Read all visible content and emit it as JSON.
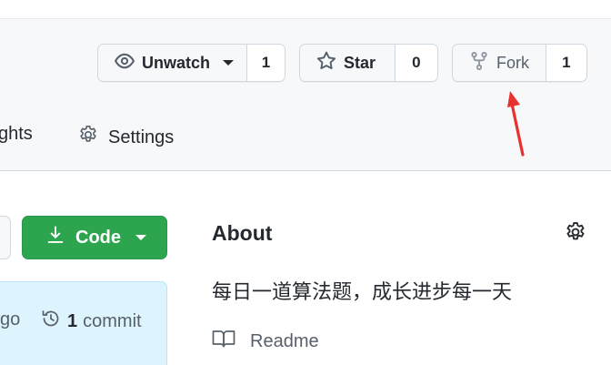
{
  "actions": {
    "watch": {
      "label": "Unwatch",
      "count": "1"
    },
    "star": {
      "label": "Star",
      "count": "0"
    },
    "fork": {
      "label": "Fork",
      "count": "1"
    }
  },
  "nav": {
    "insights_fragment": "ghts",
    "settings_label": "Settings"
  },
  "code_button": {
    "label": "Code"
  },
  "commits": {
    "ago_fragment": "go",
    "count": "1",
    "label": "commit"
  },
  "about": {
    "title": "About",
    "description": "每日一道算法题，成长进步每一天",
    "readme_label": "Readme"
  },
  "colors": {
    "accent_green": "#2da44e",
    "annotation_arrow": "#e8322f",
    "header_bg": "#f6f8fa",
    "commit_box_bg": "#ddf4ff"
  },
  "icons": [
    "eye-icon",
    "star-icon",
    "repo-forked-icon",
    "gear-icon",
    "download-icon",
    "history-icon",
    "book-icon"
  ]
}
